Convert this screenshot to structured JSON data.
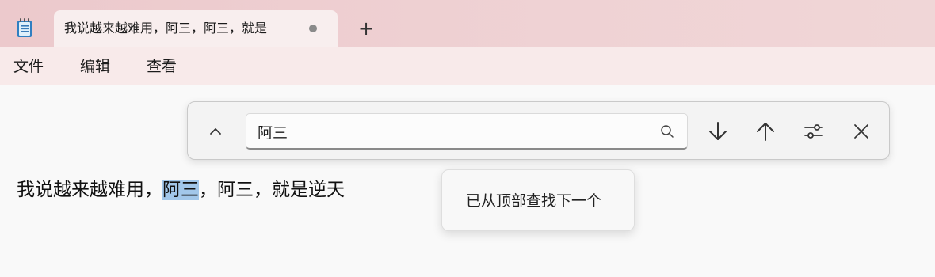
{
  "tab": {
    "title": "我说越来越难用，阿三，阿三，就是",
    "new_tab_symbol": "+"
  },
  "menu": {
    "items": [
      {
        "label": "文件"
      },
      {
        "label": "编辑"
      },
      {
        "label": "查看"
      }
    ]
  },
  "find_bar": {
    "search_value": "阿三",
    "icons": {
      "toggle": "chevron-up-icon",
      "search": "search-icon",
      "next": "arrow-down-icon",
      "previous": "arrow-up-icon",
      "options": "settings-sliders-icon",
      "close": "close-icon"
    }
  },
  "document": {
    "before": "我说越来越难用，",
    "match": "阿三",
    "after": "，阿三，就是逆天"
  },
  "tooltip": {
    "text": "已从顶部查找下一个"
  },
  "colors": {
    "titlebar": "#ecc9cc",
    "menubar": "#f8eaea",
    "highlight": "#a2c7ea"
  }
}
